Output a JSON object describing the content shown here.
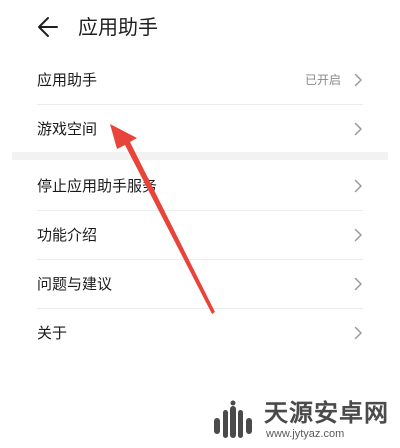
{
  "header": {
    "title": "应用助手",
    "back_icon": "arrow-left-icon"
  },
  "settings": {
    "group1": [
      {
        "label": "应用助手",
        "value": "已开启"
      },
      {
        "label": "游戏空间"
      }
    ],
    "group2": [
      {
        "label": "停止应用助手服务"
      },
      {
        "label": "功能介绍"
      },
      {
        "label": "问题与建议"
      },
      {
        "label": "关于"
      }
    ]
  },
  "annotation": {
    "type": "red-arrow",
    "points_to": "游戏空间",
    "color": "#e8443a"
  },
  "watermark": {
    "title": "天源安卓网",
    "url": "www.jytyaz.com"
  },
  "colors": {
    "chevron": "#9a9a9a",
    "value_text": "#8a8a8a",
    "separator": "#f2f2f2"
  }
}
